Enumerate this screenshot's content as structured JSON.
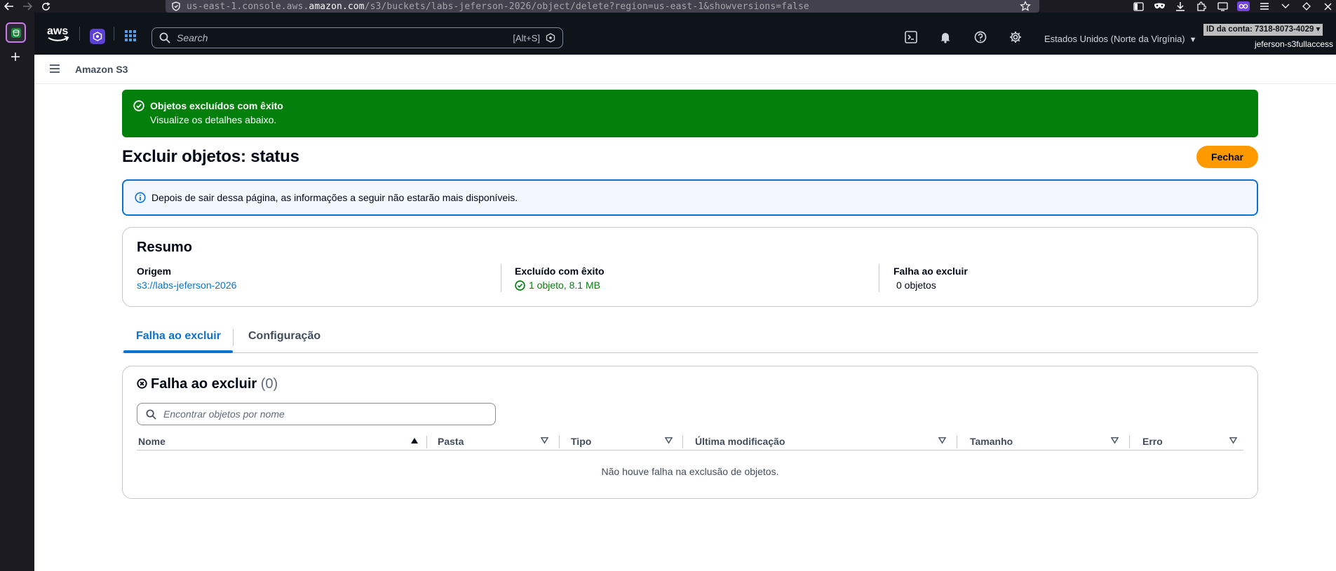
{
  "browser": {
    "url_prefix": "us-east-1.console.aws.",
    "url_domain": "amazon.com",
    "url_path": "/s3/buckets/labs-jeferson-2026/object/delete?region=us-east-1&showversions=false"
  },
  "topnav": {
    "search_placeholder": "Search",
    "search_shortcut": "[Alt+S]",
    "region": "Estados Unidos (Norte da Virgínia)",
    "account_id": "ID da conta: 7318-8073-4029",
    "account_user": "jeferson-s3fullaccess"
  },
  "service": {
    "name": "Amazon S3"
  },
  "flash": {
    "title": "Objetos excluídos com êxito",
    "message": "Visualize os detalhes abaixo."
  },
  "page": {
    "title": "Excluir objetos: status",
    "close_label": "Fechar"
  },
  "info": {
    "message": "Depois de sair dessa página, as informações a seguir não estarão mais disponíveis."
  },
  "summary": {
    "title": "Resumo",
    "source_label": "Origem",
    "source_value": "s3://labs-jeferson-2026",
    "success_label": "Excluído com êxito",
    "success_value": "1 objeto, 8.1 MB",
    "failed_label": "Falha ao excluir",
    "failed_value": "0 objetos"
  },
  "tabs": [
    {
      "label": "Falha ao excluir",
      "active": true
    },
    {
      "label": "Configuração",
      "active": false
    }
  ],
  "failed_table": {
    "title": "Falha ao excluir",
    "count": "(0)",
    "filter_placeholder": "Encontrar objetos por nome",
    "columns": [
      "Nome",
      "Pasta",
      "Tipo",
      "Última modificação",
      "Tamanho",
      "Erro"
    ],
    "sorted_column": "Nome",
    "empty_message": "Não houve falha na exclusão de objetos."
  },
  "colors": {
    "success_green": "#037f0c",
    "info_blue": "#0972d3",
    "primary_orange": "#ff9900",
    "nav_dark": "#0f141a"
  }
}
